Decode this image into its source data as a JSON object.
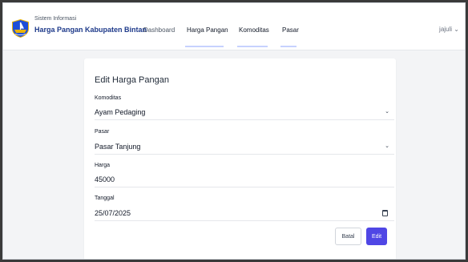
{
  "brand": {
    "subtitle": "Sistem Informasi",
    "title": "Harga Pangan Kabupaten Bintan"
  },
  "nav": {
    "items": [
      {
        "label": "Dashboard"
      },
      {
        "label": "Harga Pangan"
      },
      {
        "label": "Komoditas"
      },
      {
        "label": "Pasar"
      }
    ]
  },
  "user": {
    "name": "jajuli",
    "caret": "⌄"
  },
  "form": {
    "title": "Edit Harga Pangan",
    "komoditas": {
      "label": "Komoditas",
      "value": "Ayam Pedaging"
    },
    "pasar": {
      "label": "Pasar",
      "value": "Pasar Tanjung"
    },
    "harga": {
      "label": "Harga",
      "value": "45000"
    },
    "tanggal": {
      "label": "Tanggal",
      "value": "25/07/2025"
    },
    "chevron": "⌄",
    "cancel_label": "Batal",
    "submit_label": "Edit"
  },
  "colors": {
    "brand": "#1e3a8a",
    "accent": "#4f46e5"
  },
  "icons": {
    "logo": "bintan-emblem-icon",
    "select": "chevron-down-icon",
    "date": "calendar-icon"
  }
}
